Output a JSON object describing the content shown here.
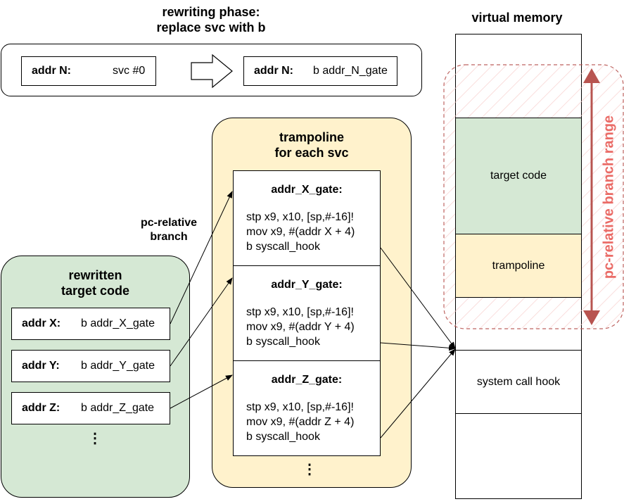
{
  "rewriting": {
    "title_line1": "rewriting phase:",
    "title_line2": "replace svc with b",
    "before": {
      "label": "addr N:",
      "instr": "svc #0"
    },
    "after": {
      "label": "addr N:",
      "instr": "b addr_N_gate"
    }
  },
  "target": {
    "title_line1": "rewritten",
    "title_line2": "target code",
    "rows": [
      {
        "label": "addr X:",
        "instr": "b addr_X_gate"
      },
      {
        "label": "addr Y:",
        "instr": "b addr_Y_gate"
      },
      {
        "label": "addr Z:",
        "instr": "b addr_Z_gate"
      }
    ],
    "more": "⋮",
    "color": "#d5e8d4"
  },
  "branch_label_line1": "pc-relative",
  "branch_label_line2": "branch",
  "trampoline": {
    "title_line1": "trampoline",
    "title_line2": "for each svc",
    "color": "#fff2cc",
    "more": "⋮",
    "gates": [
      {
        "name": "addr_X_gate:",
        "lines": [
          "stp x9, x10, [sp,#-16]!",
          "mov x9, #(addr X + 4)",
          "b syscall_hook"
        ]
      },
      {
        "name": "addr_Y_gate:",
        "lines": [
          "stp x9, x10, [sp,#-16]!",
          "mov x9, #(addr Y + 4)",
          "b syscall_hook"
        ]
      },
      {
        "name": "addr_Z_gate:",
        "lines": [
          "stp x9, x10, [sp,#-16]!",
          "mov x9, #(addr Z + 4)",
          "b syscall_hook"
        ]
      }
    ]
  },
  "memory": {
    "title": "virtual memory",
    "regions": [
      "target code",
      "trampoline",
      "system call hook"
    ],
    "range_label": "pc-relative branch range",
    "range_color": "#b85450"
  }
}
